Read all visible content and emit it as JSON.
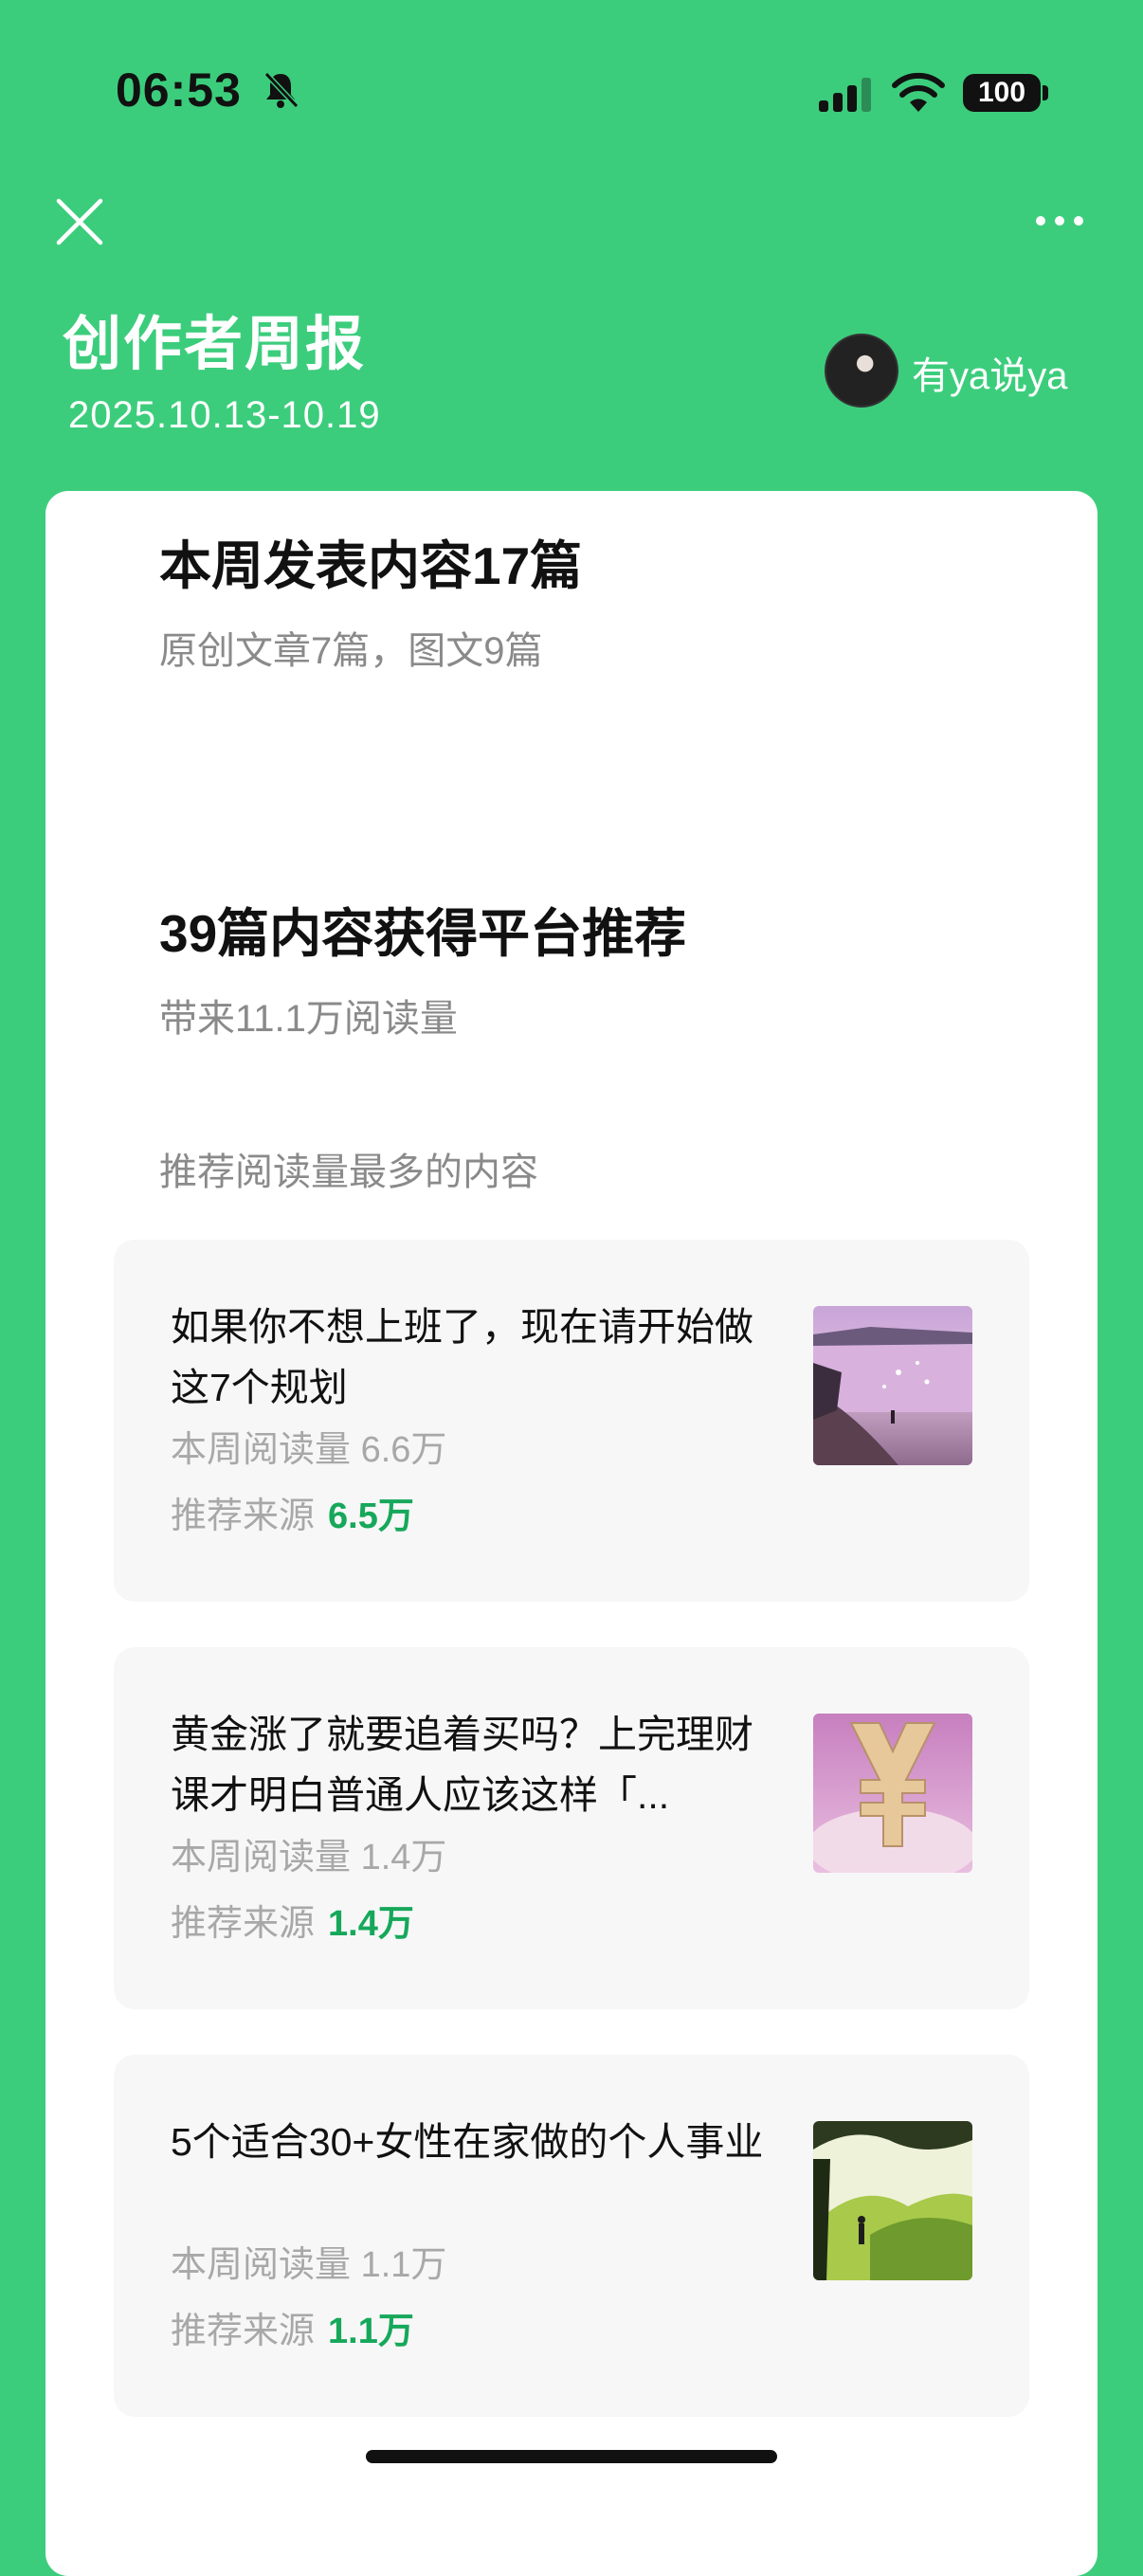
{
  "status_bar": {
    "time": "06:53",
    "battery": "100"
  },
  "header": {
    "title": "创作者周报",
    "date_range": "2025.10.13-10.19",
    "author_name": "有ya说ya"
  },
  "summary": {
    "published_heading": "本周发表内容17篇",
    "published_sub": "原创文章7篇，图文9篇",
    "recommended_heading": "39篇内容获得平台推荐",
    "recommended_sub": "带来11.1万阅读量"
  },
  "top_content": {
    "label": "推荐阅读量最多的内容",
    "articles": [
      {
        "title": "如果你不想上班了，现在请开始做这7个规划",
        "reads_label": "本周阅读量",
        "reads": "6.6万",
        "rec_label": "推荐来源",
        "rec": "6.5万"
      },
      {
        "title": "黄金涨了就要追着买吗？上完理财课才明白普通人应该这样「...",
        "reads_label": "本周阅读量",
        "reads": "1.4万",
        "rec_label": "推荐来源",
        "rec": "1.4万"
      },
      {
        "title": "5个适合30+女性在家做的个人事业",
        "reads_label": "本周阅读量",
        "reads": "1.1万",
        "rec_label": "推荐来源",
        "rec": "1.1万"
      }
    ]
  },
  "colors": {
    "background": "#3ccd7c",
    "accent_green": "#16a85a"
  }
}
